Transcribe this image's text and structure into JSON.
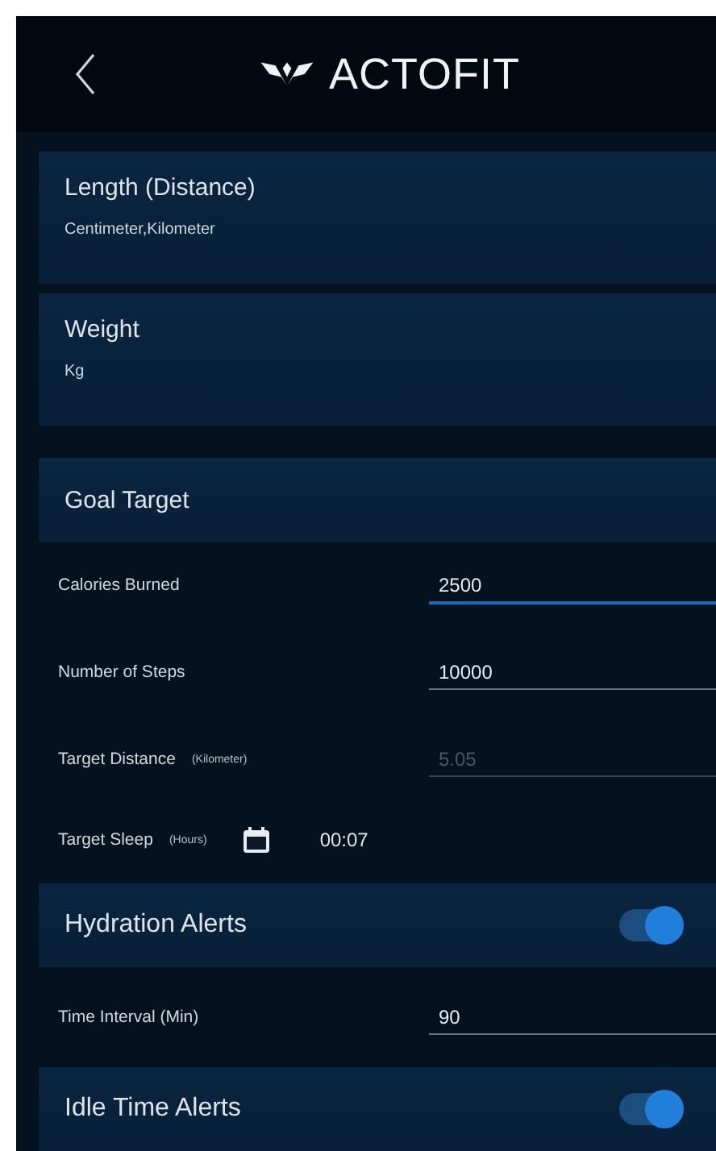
{
  "header": {
    "title": "ACTOFIT"
  },
  "sections": [
    {
      "kind": "unit",
      "title": "Length (Distance)",
      "value": "Centimeter,Kilometer"
    },
    {
      "kind": "unit",
      "title": "Weight",
      "value": "Kg"
    },
    {
      "kind": "header",
      "title": "Goal Target"
    },
    {
      "kind": "field",
      "label": "Calories Burned",
      "value": "2500",
      "focused": true,
      "disabled": false
    },
    {
      "kind": "field",
      "label": "Number of Steps",
      "value": "10000",
      "focused": false,
      "disabled": false
    },
    {
      "kind": "field",
      "label": "Target Distance",
      "unit": "(Kilometer)",
      "value": "5.05",
      "focused": false,
      "disabled": true
    },
    {
      "kind": "time",
      "label": "Target Sleep",
      "unit": "(Hours)",
      "value": "00:07"
    },
    {
      "kind": "toggle",
      "title": "Hydration Alerts",
      "on": true
    },
    {
      "kind": "field",
      "label": "Time Interval  (Min)",
      "value": "90",
      "focused": false,
      "disabled": false
    },
    {
      "kind": "toggle",
      "title": "Idle Time Alerts",
      "on": true
    }
  ]
}
